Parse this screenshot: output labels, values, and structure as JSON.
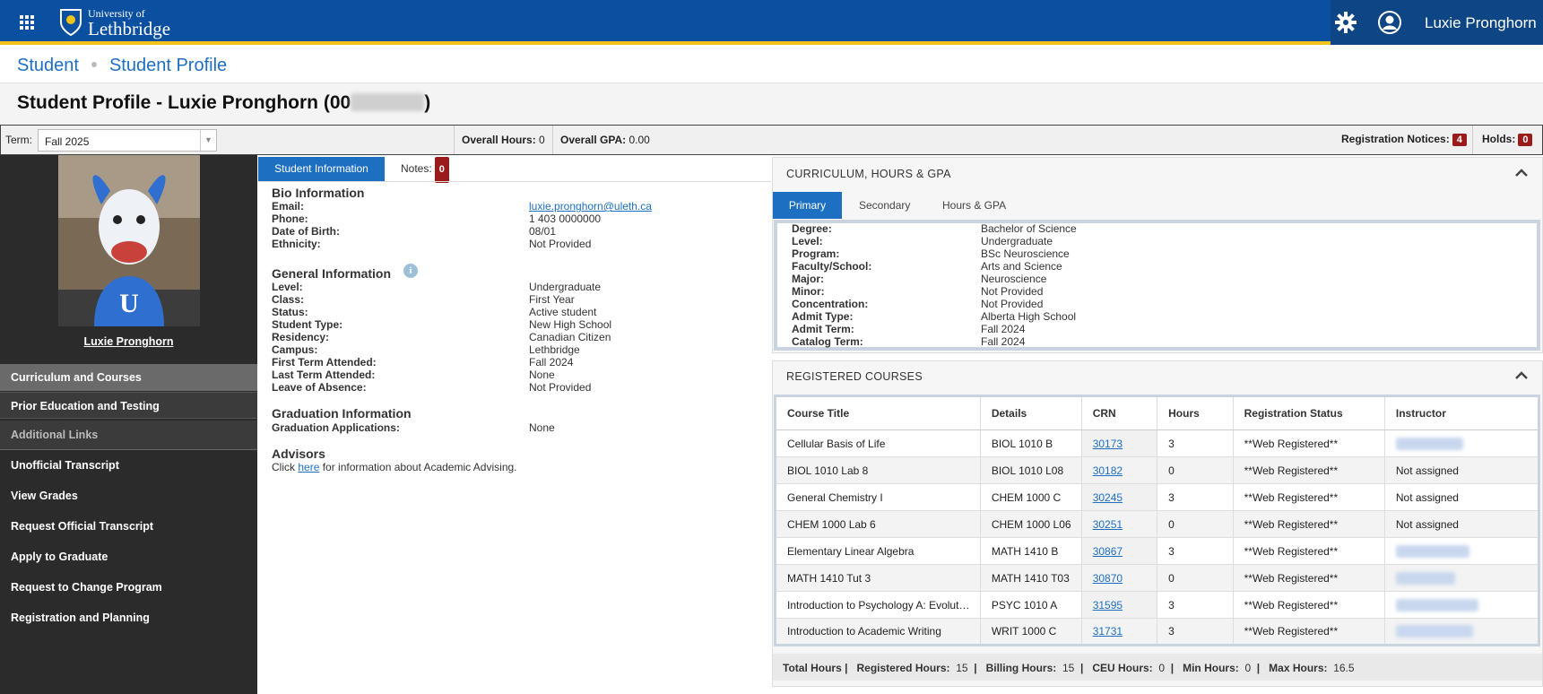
{
  "header": {
    "logo_line1": "University of",
    "logo_line2": "Lethbridge",
    "user_name": "Luxie Pronghorn"
  },
  "breadcrumb": {
    "item1": "Student",
    "item2": "Student Profile"
  },
  "page_title": "Student Profile - Luxie Pronghorn (00",
  "page_title_close": ")",
  "termbar": {
    "term_label": "Term:",
    "term_value": "Fall 2025",
    "overall_hours_label": "Overall Hours:",
    "overall_hours_value": "0",
    "overall_gpa_label": "Overall GPA:",
    "overall_gpa_value": "0.00",
    "reg_notices_label": "Registration Notices:",
    "reg_notices_count": "4",
    "holds_label": "Holds:",
    "holds_count": "0"
  },
  "sidebar": {
    "student_name": "Luxie Pronghorn",
    "items": [
      "Curriculum and Courses",
      "Prior Education and Testing",
      "Additional Links",
      "Unofficial Transcript",
      "View Grades",
      "Request Official Transcript",
      "Apply to Graduate",
      "Request to Change Program",
      "Registration and Planning"
    ]
  },
  "info_tabs": {
    "active": "Student Information",
    "notes_label": "Notes:",
    "notes_count": "0"
  },
  "bio": {
    "heading": "Bio Information",
    "rows": [
      {
        "label": "Email:",
        "value": "luxie.pronghorn@uleth.ca"
      },
      {
        "label": "Phone:",
        "value": "1 403 0000000"
      },
      {
        "label": "Date of Birth:",
        "value": "08/01"
      },
      {
        "label": "Ethnicity:",
        "value": "Not Provided"
      }
    ]
  },
  "general": {
    "heading": "General Information",
    "info_icon": "i",
    "rows": [
      {
        "label": "Level:",
        "value": "Undergraduate"
      },
      {
        "label": "Class:",
        "value": "First Year"
      },
      {
        "label": "Status:",
        "value": "Active student"
      },
      {
        "label": "Student Type:",
        "value": "New High School"
      },
      {
        "label": "Residency:",
        "value": "Canadian Citizen"
      },
      {
        "label": "Campus:",
        "value": "Lethbridge"
      },
      {
        "label": "First Term Attended:",
        "value": "Fall 2024"
      },
      {
        "label": "Last Term Attended:",
        "value": "None"
      },
      {
        "label": "Leave of Absence:",
        "value": "Not Provided"
      }
    ]
  },
  "graduation": {
    "heading": "Graduation Information",
    "label": "Graduation Applications:",
    "value": "None"
  },
  "advisors": {
    "heading": "Advisors",
    "text_before": "Click ",
    "link": "here",
    "text_after": " for information about Academic Advising."
  },
  "curriculum": {
    "heading": "CURRICULUM, HOURS & GPA",
    "tabs": [
      "Primary",
      "Secondary",
      "Hours & GPA"
    ],
    "rows": [
      {
        "label": "Degree:",
        "value": "Bachelor of Science"
      },
      {
        "label": "Level:",
        "value": "Undergraduate"
      },
      {
        "label": "Program:",
        "value": "BSc Neuroscience"
      },
      {
        "label": "Faculty/School:",
        "value": "Arts and Science"
      },
      {
        "label": "Major:",
        "value": "Neuroscience"
      },
      {
        "label": "Minor:",
        "value": "Not Provided"
      },
      {
        "label": "Concentration:",
        "value": "Not Provided"
      },
      {
        "label": "Admit Type:",
        "value": "Alberta High School"
      },
      {
        "label": "Admit Term:",
        "value": "Fall 2024"
      },
      {
        "label": "Catalog Term:",
        "value": "Fall 2024"
      }
    ]
  },
  "registered": {
    "heading": "REGISTERED COURSES",
    "columns": [
      "Course Title",
      "Details",
      "CRN",
      "Hours",
      "Registration Status",
      "Instructor"
    ],
    "rows": [
      {
        "title": "Cellular Basis of Life",
        "details": "BIOL 1010 B",
        "crn": "30173",
        "hours": "3",
        "status": "**Web Registered**",
        "instructor": ""
      },
      {
        "title": "BIOL 1010 Lab 8",
        "details": "BIOL 1010 L08",
        "crn": "30182",
        "hours": "0",
        "status": "**Web Registered**",
        "instructor": "Not assigned"
      },
      {
        "title": "General Chemistry I",
        "details": "CHEM 1000 C",
        "crn": "30245",
        "hours": "3",
        "status": "**Web Registered**",
        "instructor": "Not assigned"
      },
      {
        "title": "CHEM 1000 Lab 6",
        "details": "CHEM 1000 L06",
        "crn": "30251",
        "hours": "0",
        "status": "**Web Registered**",
        "instructor": "Not assigned"
      },
      {
        "title": "Elementary Linear Algebra",
        "details": "MATH 1410 B",
        "crn": "30867",
        "hours": "3",
        "status": "**Web Registered**",
        "instructor": ""
      },
      {
        "title": "MATH 1410 Tut 3",
        "details": "MATH 1410 T03",
        "crn": "30870",
        "hours": "0",
        "status": "**Web Registered**",
        "instructor": ""
      },
      {
        "title": "Introduction to Psychology A: Evolut…",
        "details": "PSYC 1010 A",
        "crn": "31595",
        "hours": "3",
        "status": "**Web Registered**",
        "instructor": ""
      },
      {
        "title": "Introduction to Academic Writing",
        "details": "WRIT 1000 C",
        "crn": "31731",
        "hours": "3",
        "status": "**Web Registered**",
        "instructor": ""
      }
    ],
    "totals": {
      "label": "Total Hours |",
      "registered_label": "Registered Hours:",
      "registered": "15",
      "billing_label": "Billing Hours:",
      "billing": "15",
      "ceu_label": "CEU Hours:",
      "ceu": "0",
      "min_label": "Min Hours:",
      "min": "0",
      "max_label": "Max Hours:",
      "max": "16.5"
    }
  },
  "colors": {
    "brand_blue": "#0a4fa0",
    "accent_gold": "#f4c31a",
    "badge_red": "#9b1b1b",
    "link_blue": "#1d6fc2"
  }
}
